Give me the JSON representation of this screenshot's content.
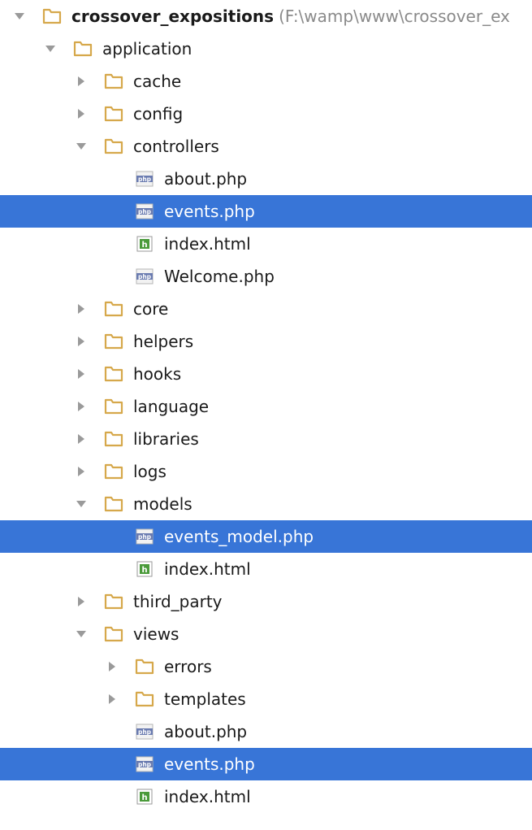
{
  "tree": {
    "rows": [
      {
        "label": "crossover_expositions",
        "path": "(F:\\wamp\\www\\crossover_ex",
        "type": "folder",
        "state": "expanded",
        "depth": 0,
        "root": true,
        "icon": "folder-icon"
      },
      {
        "label": "application",
        "type": "folder",
        "state": "expanded",
        "depth": 1,
        "icon": "folder-icon"
      },
      {
        "label": "cache",
        "type": "folder",
        "state": "collapsed",
        "depth": 2,
        "icon": "folder-icon"
      },
      {
        "label": "config",
        "type": "folder",
        "state": "collapsed",
        "depth": 2,
        "icon": "folder-icon"
      },
      {
        "label": "controllers",
        "type": "folder",
        "state": "expanded",
        "depth": 2,
        "icon": "folder-icon"
      },
      {
        "label": "about.php",
        "type": "php",
        "depth": 3,
        "icon": "php-file-icon"
      },
      {
        "label": "events.php",
        "type": "php",
        "depth": 3,
        "selected": true,
        "icon": "php-file-icon"
      },
      {
        "label": "index.html",
        "type": "html",
        "depth": 3,
        "icon": "html-file-icon"
      },
      {
        "label": "Welcome.php",
        "type": "php",
        "depth": 3,
        "icon": "php-file-icon"
      },
      {
        "label": "core",
        "type": "folder",
        "state": "collapsed",
        "depth": 2,
        "icon": "folder-icon"
      },
      {
        "label": "helpers",
        "type": "folder",
        "state": "collapsed",
        "depth": 2,
        "icon": "folder-icon"
      },
      {
        "label": "hooks",
        "type": "folder",
        "state": "collapsed",
        "depth": 2,
        "icon": "folder-icon"
      },
      {
        "label": "language",
        "type": "folder",
        "state": "collapsed",
        "depth": 2,
        "icon": "folder-icon"
      },
      {
        "label": "libraries",
        "type": "folder",
        "state": "collapsed",
        "depth": 2,
        "icon": "folder-icon"
      },
      {
        "label": "logs",
        "type": "folder",
        "state": "collapsed",
        "depth": 2,
        "icon": "folder-icon"
      },
      {
        "label": "models",
        "type": "folder",
        "state": "expanded",
        "depth": 2,
        "icon": "folder-icon"
      },
      {
        "label": "events_model.php",
        "type": "php",
        "depth": 3,
        "selected": true,
        "icon": "php-file-icon"
      },
      {
        "label": "index.html",
        "type": "html",
        "depth": 3,
        "icon": "html-file-icon"
      },
      {
        "label": "third_party",
        "type": "folder",
        "state": "collapsed",
        "depth": 2,
        "icon": "folder-icon"
      },
      {
        "label": "views",
        "type": "folder",
        "state": "expanded",
        "depth": 2,
        "icon": "folder-icon"
      },
      {
        "label": "errors",
        "type": "folder",
        "state": "collapsed",
        "depth": 3,
        "icon": "folder-icon"
      },
      {
        "label": "templates",
        "type": "folder",
        "state": "collapsed",
        "depth": 3,
        "icon": "folder-icon"
      },
      {
        "label": "about.php",
        "type": "php",
        "depth": 3,
        "icon": "php-file-icon"
      },
      {
        "label": "events.php",
        "type": "php",
        "depth": 3,
        "selected": true,
        "icon": "php-file-icon"
      },
      {
        "label": "index.html",
        "type": "html",
        "depth": 3,
        "icon": "html-file-icon"
      }
    ]
  },
  "colors": {
    "selection": "#3875d7",
    "folder": "#d6a84b",
    "arrow": "#9a9a9a",
    "path_text": "#8a8a8a",
    "html_icon": "#4a9a3a",
    "php_icon": "#6a7bb0"
  },
  "icons": {
    "php_badge_text": "php",
    "html_badge_text": "h"
  }
}
